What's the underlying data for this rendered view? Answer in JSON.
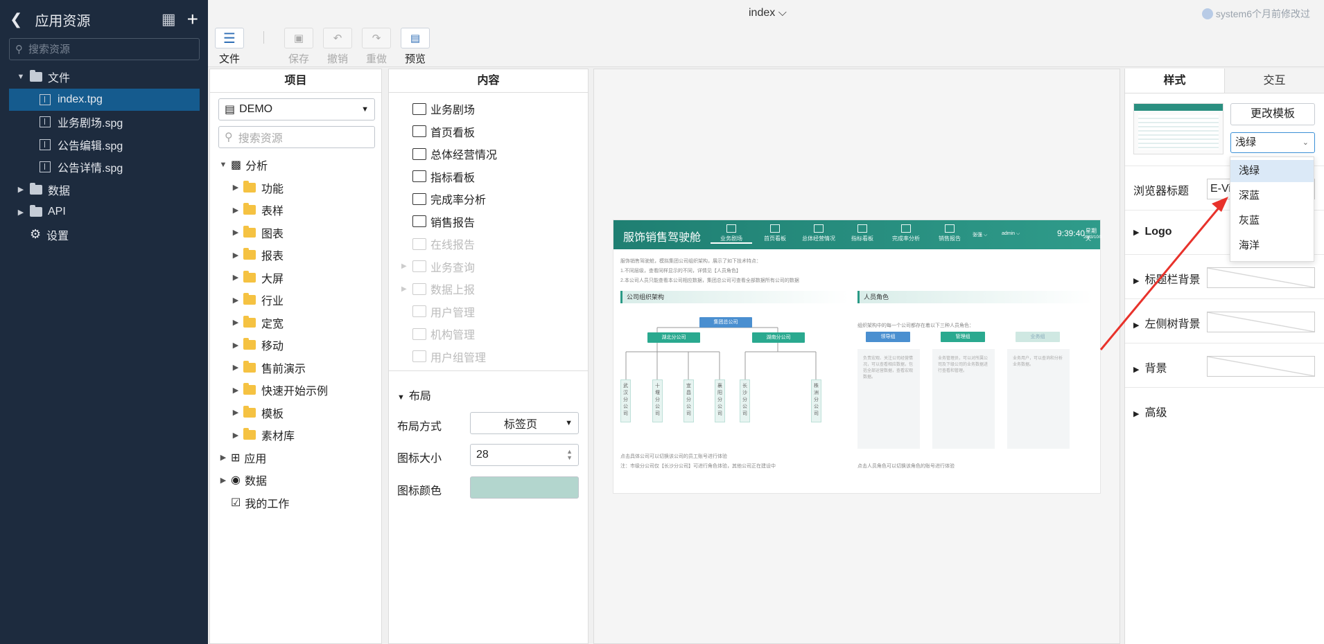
{
  "sidebar": {
    "title": "应用资源",
    "search_placeholder": "搜索资源",
    "items": [
      {
        "label": "文件"
      },
      {
        "label": "index.tpg"
      },
      {
        "label": "业务剧场.spg"
      },
      {
        "label": "公告编辑.spg"
      },
      {
        "label": "公告详情.spg"
      },
      {
        "label": "数据"
      },
      {
        "label": "API"
      },
      {
        "label": "设置"
      }
    ]
  },
  "topbar": {
    "doc_title": "index ⌵",
    "user": "system6个月前修改过",
    "buttons": {
      "file": "文件",
      "save": "保存",
      "undo": "撤销",
      "redo": "重做",
      "preview": "预览"
    }
  },
  "project": {
    "header": "项目",
    "selected": "DEMO",
    "search_placeholder": "搜索资源",
    "tree": {
      "root": "分析",
      "folders": [
        "功能",
        "表样",
        "图表",
        "报表",
        "大屏",
        "行业",
        "定宽",
        "移动",
        "售前演示",
        "快速开始示例",
        "模板",
        "素材库"
      ],
      "app": "应用",
      "data": "数据",
      "work": "我的工作"
    }
  },
  "content": {
    "header": "内容",
    "items": [
      {
        "label": "业务剧场",
        "enabled": true
      },
      {
        "label": "首页看板",
        "enabled": true
      },
      {
        "label": "总体经营情况",
        "enabled": true
      },
      {
        "label": "指标看板",
        "enabled": true
      },
      {
        "label": "完成率分析",
        "enabled": true
      },
      {
        "label": "销售报告",
        "enabled": true
      },
      {
        "label": "在线报告",
        "enabled": false
      },
      {
        "label": "业务查询",
        "enabled": false
      },
      {
        "label": "数据上报",
        "enabled": false
      },
      {
        "label": "用户管理",
        "enabled": false
      },
      {
        "label": "机构管理",
        "enabled": false
      },
      {
        "label": "用户组管理",
        "enabled": false
      }
    ],
    "layout_section": "布局",
    "layout_mode_label": "布局方式",
    "layout_mode_value": "标签页",
    "icon_size_label": "图标大小",
    "icon_size_value": "28",
    "icon_color_label": "图标颜色",
    "icon_color": "#b3d6ce"
  },
  "preview": {
    "title": "服饰销售驾驶舱",
    "nav": [
      "业务剧场",
      "首页看板",
      "总体经营情况",
      "指标看板",
      "完成率分析",
      "销售报告"
    ],
    "user1": "张强 ⌵",
    "user2": "admin ⌵",
    "time": "9:39:40",
    "weekday": "星期天",
    "date": "2023/10/8",
    "intro": [
      "服饰销售驾驶舱，模拟集团公司组织架构，展示了如下技术特点：",
      "1.不同层级，查看同样显示的不同，详情见【人员角色】",
      "2.本公司人员只能查看本公司相应数据，集团总公司可查看全部数据所有公司的数据"
    ],
    "sec1": "公司组织架构",
    "sec2": "人员角色",
    "org_root": "集团总公司",
    "org_l1": [
      "湖北分公司",
      "湖南分公司"
    ],
    "org_l2": [
      "武汉分公司",
      "十堰分公司",
      "宜昌分公司",
      "襄阳分公司",
      "长沙分公司",
      "株洲分公司"
    ],
    "role_intro": "组织架构中的每一个公司都存在着以下三种人员角色：",
    "roles": [
      "领导组",
      "管理组",
      "业务组"
    ],
    "role_desc": [
      "负责宏观、关注公司经营情况，可以查看相应数据，包括全部运营数据，查看宏观数据。",
      "业务管理员，可以对所属公司及下级公司的业务数据进行查看和管理。",
      "业务用户，可以查询和分析业务数据。"
    ],
    "foot1": "点击具体公司可以切换该公司的员工账号进行体验",
    "foot2": "注：市级分公司仅【长沙分公司】可进行角色体验，其他公司正在建设中",
    "foot3": "点击人员角色可以切换该角色的账号进行体验"
  },
  "right": {
    "tab_style": "样式",
    "tab_interaction": "交互",
    "change_template": "更改模板",
    "theme_selected": "浅绿",
    "theme_options": [
      "浅绿",
      "深蓝",
      "灰蓝",
      "海洋"
    ],
    "browser_title_label": "浏览器标题",
    "browser_title_value": "E-Vi",
    "rows": [
      "Logo",
      "标题栏背景",
      "左侧树背景",
      "背景",
      "高级"
    ]
  }
}
